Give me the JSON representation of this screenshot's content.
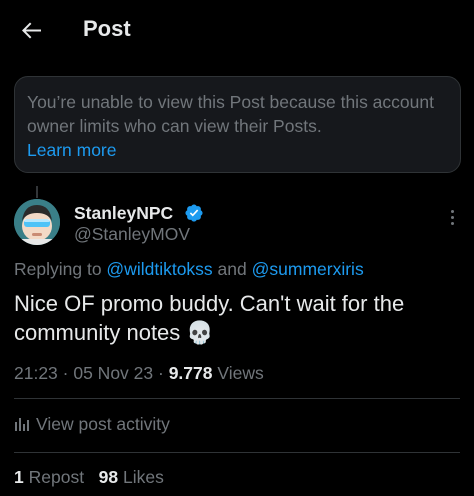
{
  "header": {
    "back_icon": "arrow-left-icon",
    "title": "Post"
  },
  "notice": {
    "text": "You’re unable to view this Post because this account owner limits who can view their Posts.",
    "link": "Learn more"
  },
  "post": {
    "author": {
      "display_name": "StanleyNPC",
      "handle": "@StanleyMOV",
      "verified": true,
      "verified_icon": "verified-badge-icon"
    },
    "more_icon": "more-vertical-icon",
    "replying_to": {
      "prefix": "Replying to ",
      "mention1": "@wildtiktokss",
      "connector": " and ",
      "mention2": "@summerxiris"
    },
    "text": "Nice OF promo buddy. Can't wait for the community notes 💀",
    "time": "21:23",
    "separator": " · ",
    "date": "05 Nov 23",
    "views_count": "9.778",
    "views_label": "Views",
    "activity_icon": "analytics-icon",
    "activity_label": "View post activity",
    "reposts_count": "1",
    "reposts_label": "Repost",
    "likes_count": "98",
    "likes_label": "Likes"
  },
  "colors": {
    "background": "#000000",
    "text_primary": "#e7e9ea",
    "text_secondary": "#71767b",
    "accent": "#1d9bf0",
    "notice_bg": "#16181c",
    "border": "#2f3336"
  }
}
